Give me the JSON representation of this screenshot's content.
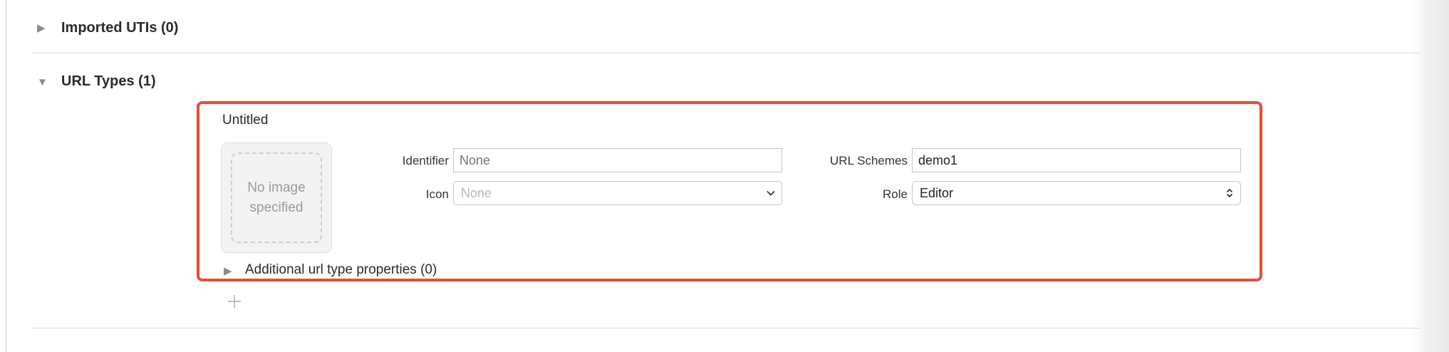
{
  "sections": {
    "imported_utis": {
      "title": "Imported UTIs (0)",
      "expanded": false
    },
    "url_types": {
      "title": "URL Types (1)",
      "expanded": true
    }
  },
  "url_type_entry": {
    "name": "Untitled",
    "image_well_text": "No image specified",
    "identifier": {
      "label": "Identifier",
      "value": "",
      "placeholder": "None"
    },
    "icon": {
      "label": "Icon",
      "value": "",
      "placeholder": "None"
    },
    "url_schemes": {
      "label": "URL Schemes",
      "value": "demo1"
    },
    "role": {
      "label": "Role",
      "value": "Editor"
    },
    "additional_properties": {
      "title": "Additional url type properties (0)",
      "expanded": false
    }
  },
  "highlight_color": "#ec4b32",
  "icons": [
    "disclosure-triangle-right",
    "disclosure-triangle-down",
    "chevron-down",
    "up-down-chevrons",
    "plus"
  ]
}
